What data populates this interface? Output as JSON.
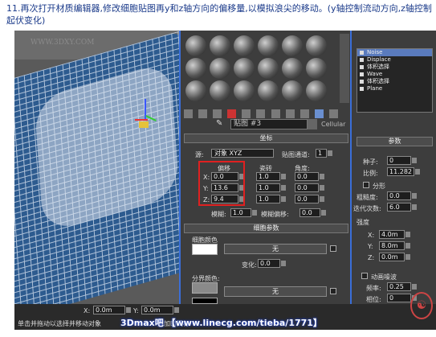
{
  "caption": "11.再次打开材质编辑器,修改细胞贴图再y和z轴方向的偏移量,以模拟浪尖的移动。(y轴控制流动方向,z轴控制起伏变化)",
  "watermark": "WWW.3DXY.COM",
  "material_editor": {
    "map_name": "贴图 #3",
    "map_type": "Cellular",
    "coords": {
      "title": "坐标",
      "source_label": "源:",
      "source_value": "对象 XYZ",
      "channel_label": "贴图通道:",
      "channel_value": "1",
      "offset_header": "偏移",
      "tiling_header": "瓷砖",
      "angle_header": "角度:",
      "rows": [
        {
          "axis": "X:",
          "offset": "0.0",
          "tiling": "1.0",
          "angle": "0.0"
        },
        {
          "axis": "Y:",
          "offset": "13.6",
          "tiling": "1.0",
          "angle": "0.0"
        },
        {
          "axis": "Z:",
          "offset": "9.4",
          "tiling": "1.0",
          "angle": "0.0"
        }
      ],
      "blur_label": "模糊:",
      "blur_value": "1.0",
      "blur_offset_label": "模糊偏移:",
      "blur_offset_value": "0.0"
    },
    "cell_params": {
      "title": "细胞参数",
      "cell_color_label": "细胞颜色",
      "none_label": "无",
      "variation_label": "变化:",
      "variation_value": "0.0",
      "division_colors_label": "分界颜色:",
      "none_label_2": "无"
    }
  },
  "command_panel": {
    "stack": [
      "Noise",
      "Displace",
      "体积选择",
      "Wave",
      "体积选择",
      "Plane"
    ],
    "params_title": "参数",
    "seed_label": "种子:",
    "seed_value": "0",
    "scale_label": "比例:",
    "scale_value": "11.282",
    "fractal_label": "分形",
    "roughness_label": "粗糙度:",
    "roughness_value": "0.0",
    "iterations_label": "迭代次数:",
    "iterations_value": "6.0",
    "strength_label": "强度",
    "x_label": "X:",
    "x_value": "4.0m",
    "y_label": "Y:",
    "y_value": "8.0m",
    "z_label": "Z:",
    "z_value": "0.0m",
    "animate_label": "动画噪波",
    "freq_label": "频率:",
    "freq_value": "0.25",
    "phase_label": "相位:",
    "phase_value": "0"
  },
  "bottom_bar": {
    "x_label": "X:",
    "x_value": "0.0m",
    "y_label": "Y:",
    "y_value": "0.0m",
    "status": "单击并拖动以选择并移动对象",
    "add_tag": "添加时间标"
  },
  "footer": "3Dmax吧 【www.linecg.com/tieba/1771】"
}
